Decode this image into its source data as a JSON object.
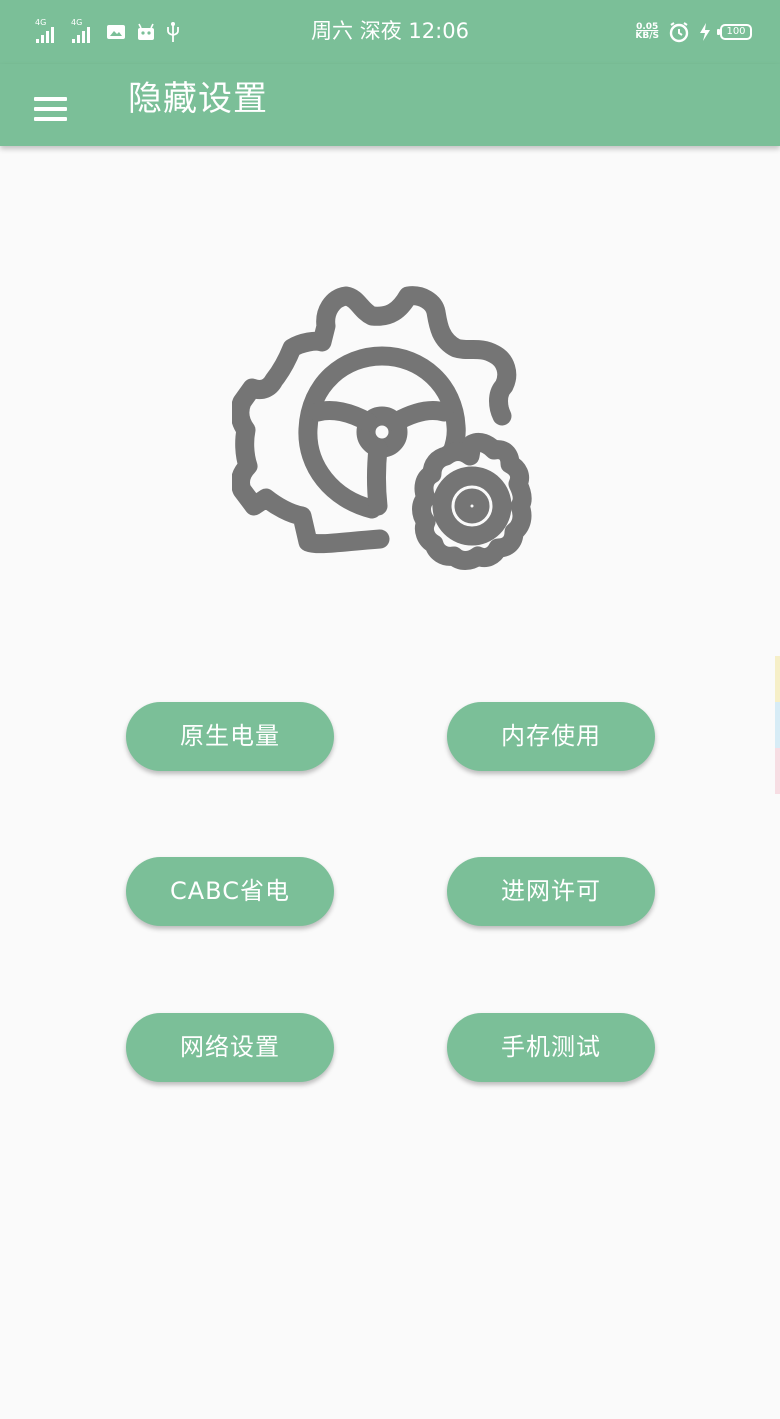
{
  "status_bar": {
    "network_1": "4G",
    "network_2": "4G",
    "time": "周六 深夜 12:06",
    "speed_value": "0.05",
    "speed_unit": "KB/S",
    "battery": "100"
  },
  "app_bar": {
    "title": "隐藏设置"
  },
  "buttons": [
    {
      "label": "原生电量"
    },
    {
      "label": "内存使用"
    },
    {
      "label": "CABC省电"
    },
    {
      "label": "进网许可"
    },
    {
      "label": "网络设置"
    },
    {
      "label": "手机测试"
    }
  ],
  "colors": {
    "primary": "#7bbf98",
    "background": "#fafafa",
    "icon": "#757575",
    "text_on_primary": "#ffffff"
  },
  "icons": [
    "signal-icon",
    "gallery-icon",
    "android-icon",
    "usb-icon",
    "alarm-icon",
    "charging-icon",
    "battery-icon",
    "menu-icon",
    "gears-icon"
  ]
}
